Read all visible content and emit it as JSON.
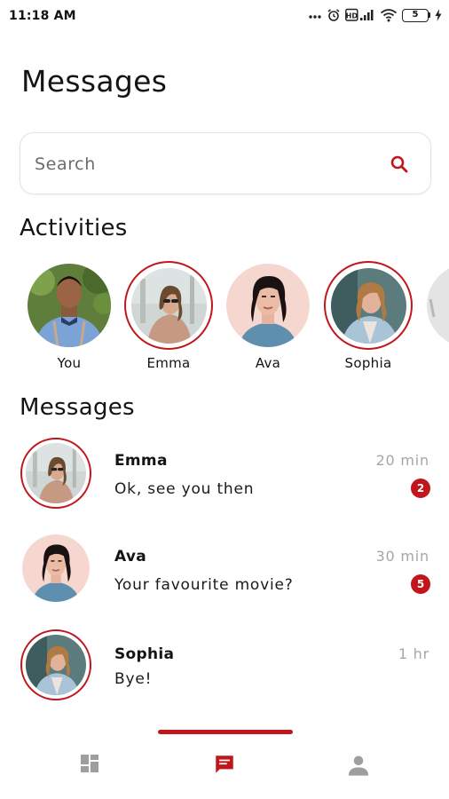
{
  "status_bar": {
    "time": "11:18 AM",
    "battery": "5"
  },
  "page": {
    "title": "Messages"
  },
  "search": {
    "placeholder": "Search"
  },
  "activities": {
    "title": "Activities",
    "items": [
      {
        "name": "You",
        "highlighted": false
      },
      {
        "name": "Emma",
        "highlighted": true
      },
      {
        "name": "Ava",
        "highlighted": false
      },
      {
        "name": "Sophia",
        "highlighted": true
      }
    ]
  },
  "messages": {
    "title": "Messages",
    "items": [
      {
        "name": "Emma",
        "preview": "Ok, see you then",
        "time": "20 min",
        "unread": "2",
        "highlighted": true
      },
      {
        "name": "Ava",
        "preview": "Your favourite movie?",
        "time": "30 min",
        "unread": "5",
        "highlighted": false
      },
      {
        "name": "Sophia",
        "preview": "Bye!",
        "time": "1 hr",
        "unread": "",
        "highlighted": true
      }
    ]
  },
  "bottom_nav": {
    "items": [
      {
        "icon": "dashboard-icon",
        "active": false
      },
      {
        "icon": "chat-icon",
        "active": true
      },
      {
        "icon": "person-icon",
        "active": false
      }
    ]
  },
  "colors": {
    "accent": "#c0161c",
    "muted_text": "#a6a6a6",
    "inactive_icon": "#9e9e9e"
  }
}
